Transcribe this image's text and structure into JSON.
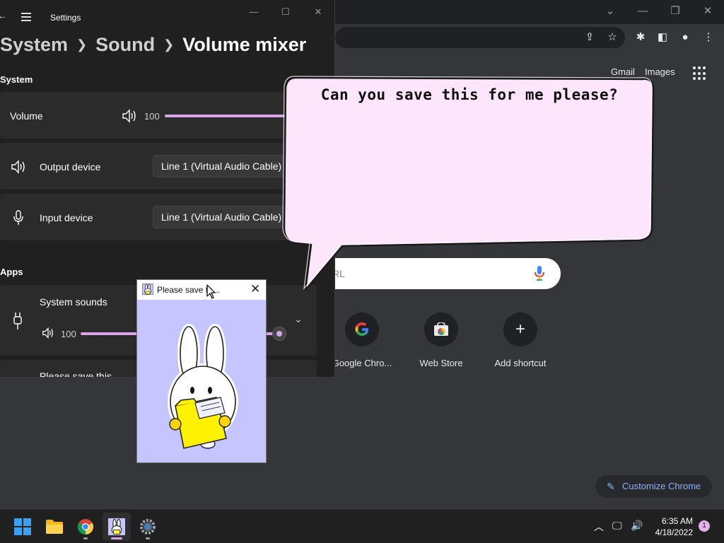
{
  "chrome": {
    "links": {
      "gmail": "Gmail",
      "images": "Images"
    },
    "search_placeholder": "RL",
    "shortcuts": [
      {
        "label": "Google Chro...",
        "icon": "google-icon"
      },
      {
        "label": "Web Store",
        "icon": "web-store-icon"
      },
      {
        "label": "Add shortcut",
        "icon": "plus-icon"
      }
    ],
    "customize_label": "Customize Chrome"
  },
  "settings": {
    "window_title": "Settings",
    "breadcrumb": [
      "System",
      "Sound",
      "Volume mixer"
    ],
    "system_section": "System",
    "volume": {
      "label": "Volume",
      "value": "100",
      "level": 100
    },
    "output_device": {
      "label": "Output device",
      "value": "Line 1 (Virtual Audio Cable)"
    },
    "input_device": {
      "label": "Input device",
      "value": "Line 1 (Virtual Audio Cable)"
    },
    "apps_section": "Apps",
    "apps": [
      {
        "name": "System sounds",
        "value": "100",
        "level": 100
      },
      {
        "name": "Please save this"
      }
    ]
  },
  "bubble": {
    "text": "Can you save this for me please?"
  },
  "popup": {
    "title": "Please save th..."
  },
  "taskbar": {
    "apps": [
      "start-icon",
      "file-explorer-icon",
      "chrome-icon",
      "bunny-app-icon",
      "settings-icon"
    ],
    "time": "6:35 AM",
    "date": "4/18/2022",
    "notifications": "1"
  },
  "colors": {
    "accent": "#d9a5e6",
    "bubble_fill": "#fde6fb",
    "popup_bg": "#c5c6ff"
  }
}
